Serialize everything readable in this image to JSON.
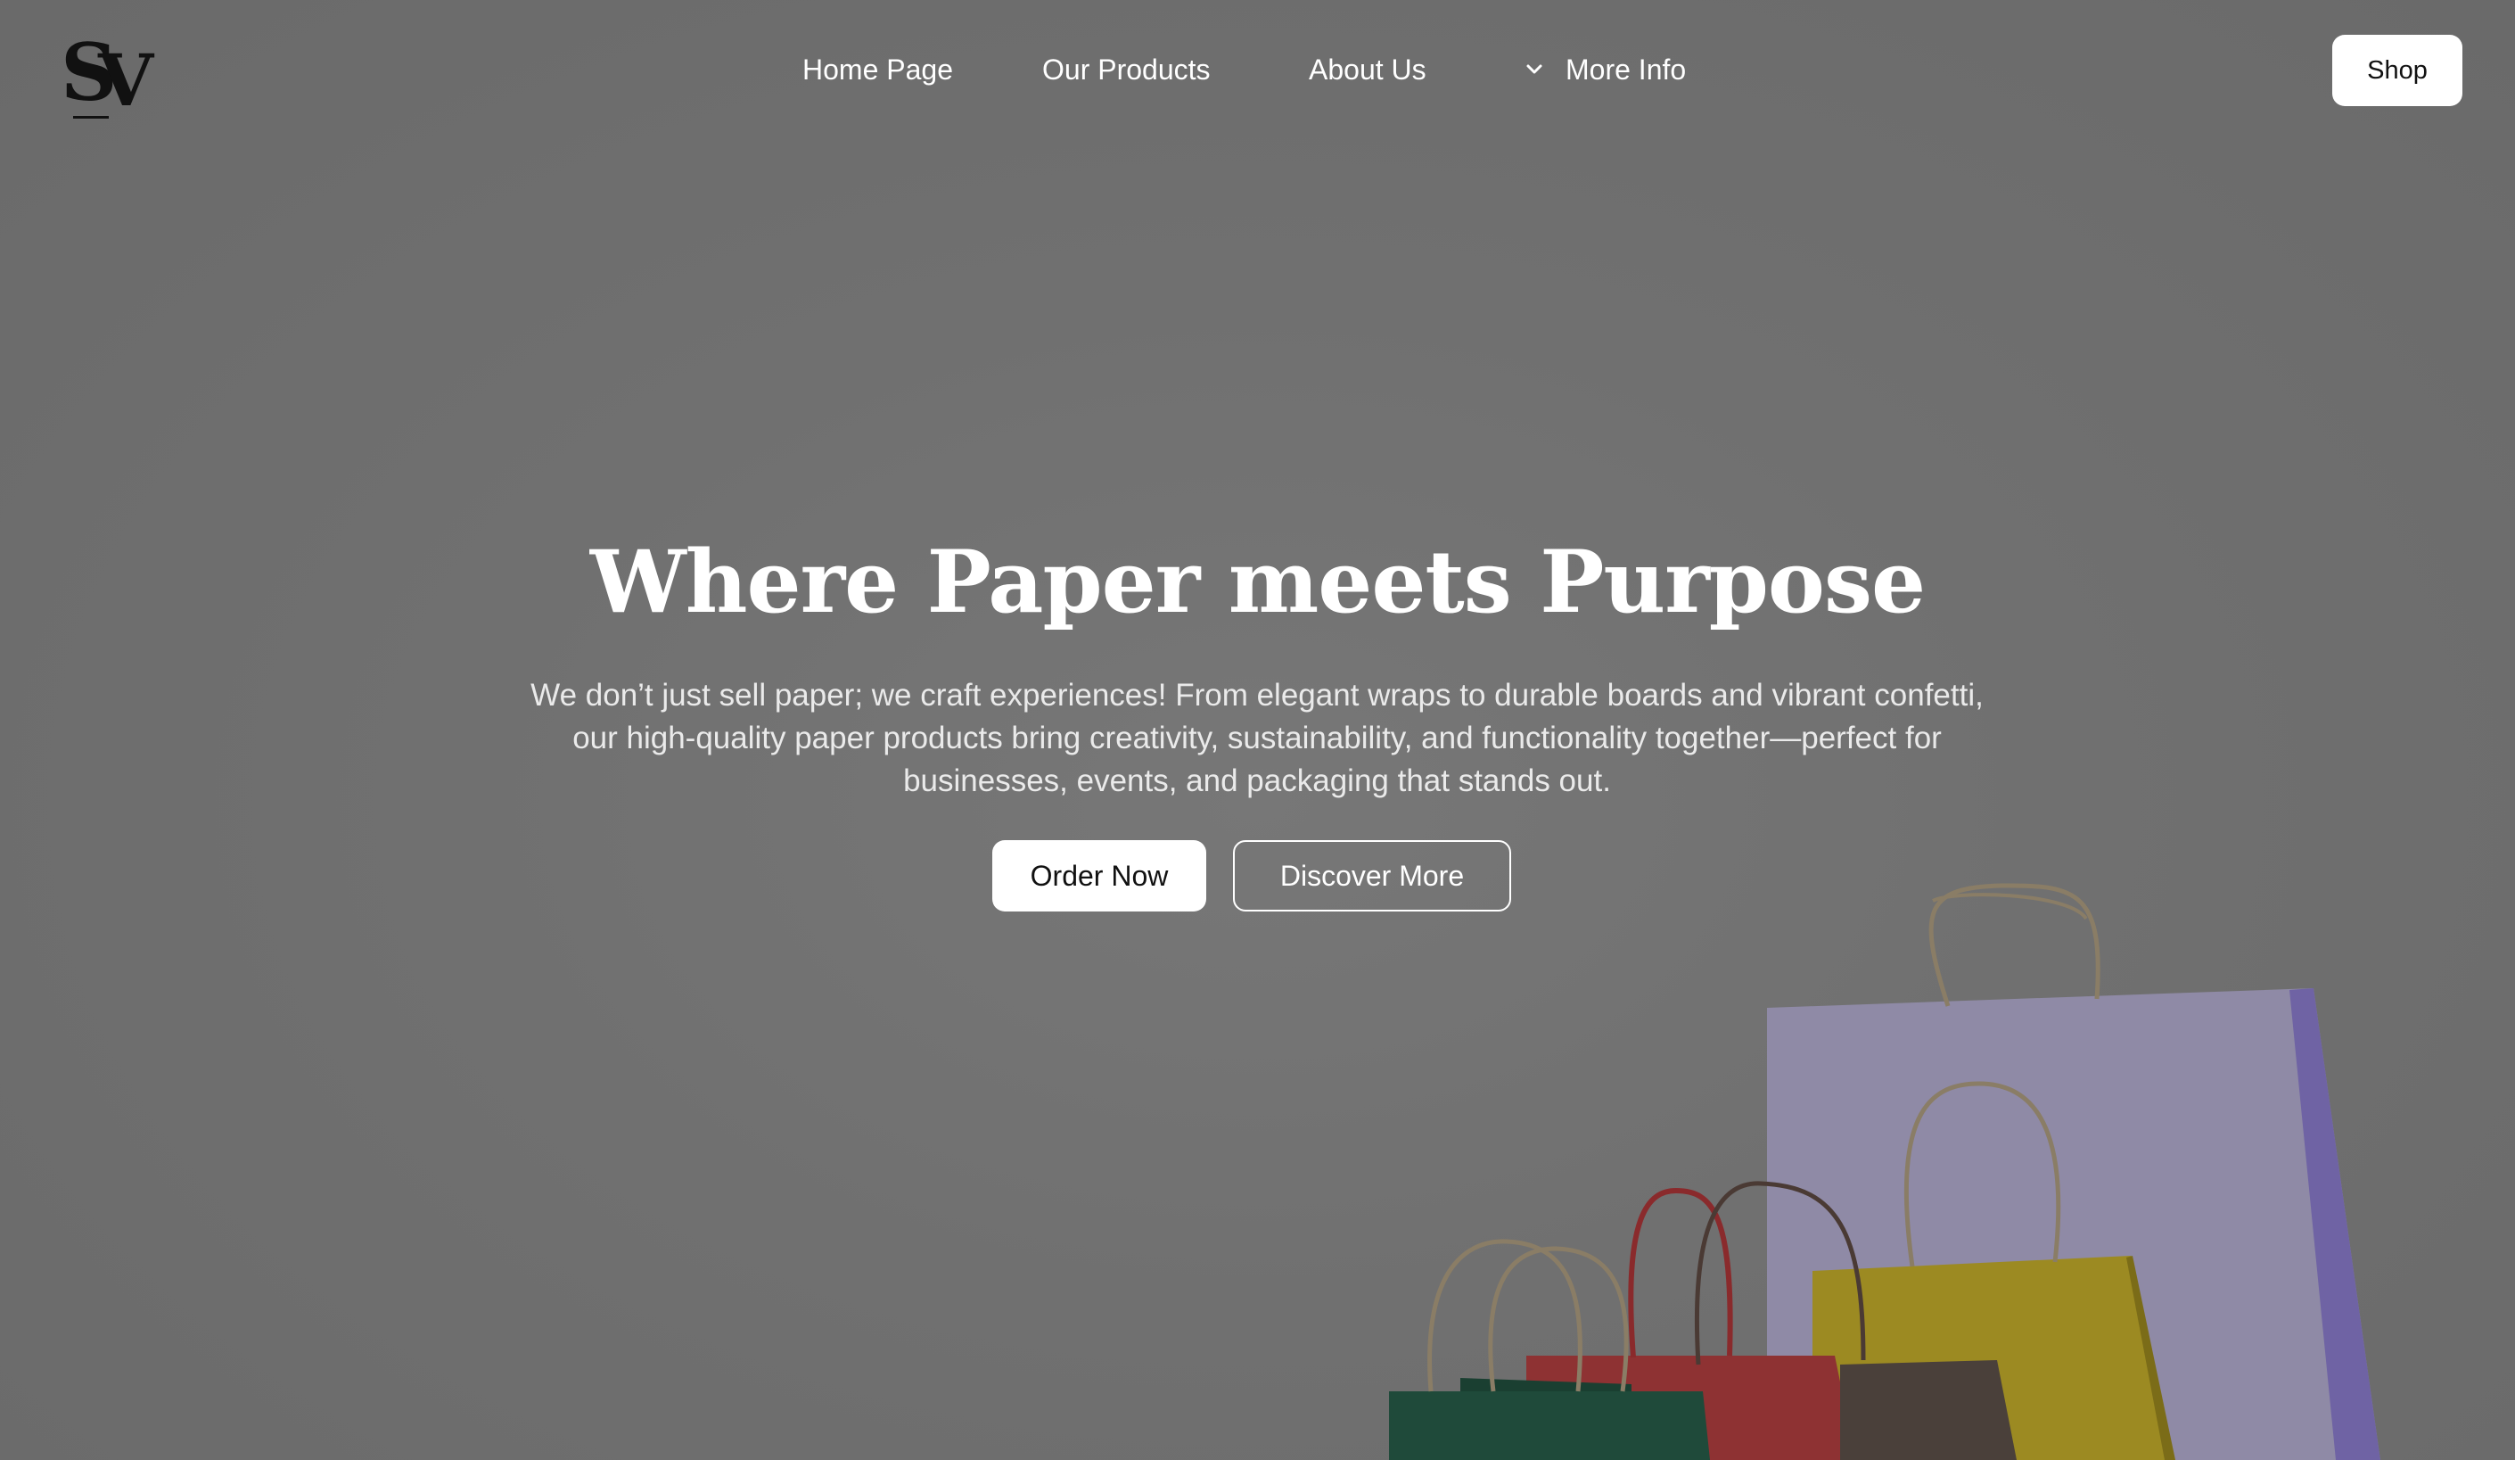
{
  "header": {
    "logo_icon": "sv-monogram-logo",
    "nav": {
      "home": "Home Page",
      "products": "Our Products",
      "about": "About Us",
      "more": "More Info"
    },
    "shop_label": "Shop"
  },
  "hero": {
    "title": "Where Paper meets Purpose",
    "description": "We don’t just sell paper; we craft experiences! From elegant wraps to durable boards and vibrant confetti, our high-quality paper products bring creativity, sustainability, and functionality together—perfect for businesses, events, and packaging that stands out.",
    "order_label": "Order Now",
    "discover_label": "Discover More"
  },
  "colors": {
    "overlay": "#6e6e6e",
    "button_bg": "#ffffff",
    "button_text": "#111111"
  }
}
